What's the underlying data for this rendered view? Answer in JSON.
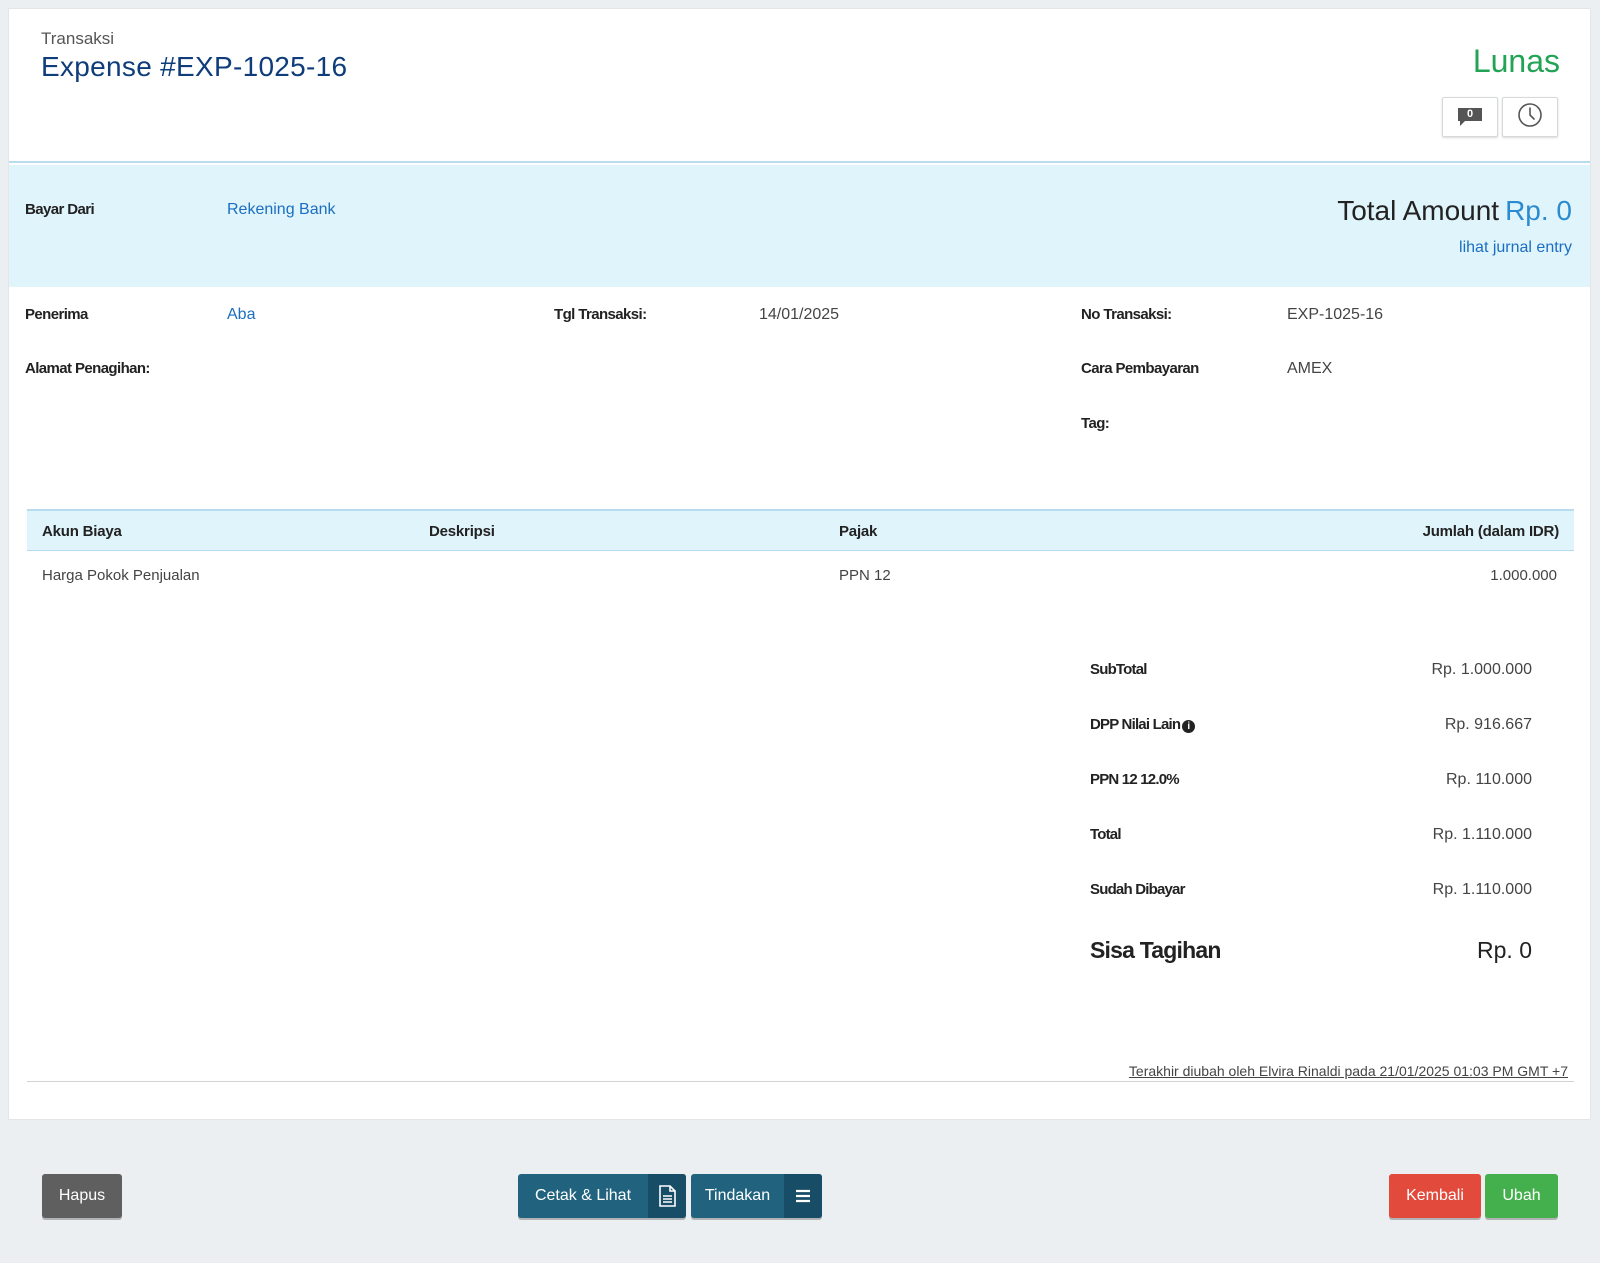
{
  "header": {
    "breadcrumb": "Transaksi",
    "title": "Expense #EXP-1025-16",
    "status": "Lunas",
    "comment_count": "0",
    "status_color": "#23a455"
  },
  "band": {
    "bayar_dari_label": "Bayar Dari",
    "bayar_dari_value": "Rekening Bank",
    "total_label": "Total Amount",
    "total_value": "Rp. 0",
    "journal_link": "lihat jurnal entry"
  },
  "details": {
    "penerima_label": "Penerima",
    "penerima_value": "Aba",
    "alamat_label": "Alamat Penagihan:",
    "tgl_label": "Tgl Transaksi:",
    "tgl_value": "14/01/2025",
    "no_label": "No Transaksi:",
    "no_value": "EXP-1025-16",
    "cara_label": "Cara Pembayaran",
    "cara_value": "AMEX",
    "tag_label": "Tag:"
  },
  "table": {
    "headers": [
      "Akun Biaya",
      "Deskripsi",
      "Pajak",
      "Jumlah (dalam IDR)"
    ],
    "rows": [
      {
        "akun": "Harga Pokok Penjualan",
        "deskripsi": "",
        "pajak": "PPN 12",
        "jumlah": "1.000.000"
      }
    ]
  },
  "summary": {
    "subtotal_label": "SubTotal",
    "subtotal_value": "Rp. 1.000.000",
    "dpp_label": "DPP Nilai Lain",
    "dpp_value": "Rp. 916.667",
    "ppn_label": "PPN 12 12.0%",
    "ppn_value": "Rp. 110.000",
    "total_label": "Total",
    "total_value": "Rp. 1.110.000",
    "dibayar_label": "Sudah Dibayar",
    "dibayar_value": "Rp. 1.110.000",
    "sisa_label": "Sisa Tagihan",
    "sisa_value": "Rp. 0"
  },
  "audit": "Terakhir diubah oleh Elvira Rinaldi pada 21/01/2025 01:03 PM GMT +7",
  "footer": {
    "hapus": "Hapus",
    "cetak": "Cetak & Lihat",
    "tindakan": "Tindakan",
    "kembali": "Kembali",
    "ubah": "Ubah"
  },
  "icons": {
    "comment": "comment-icon",
    "history": "clock-icon",
    "info": "info-icon",
    "document": "document-icon",
    "menu": "menu-icon"
  }
}
